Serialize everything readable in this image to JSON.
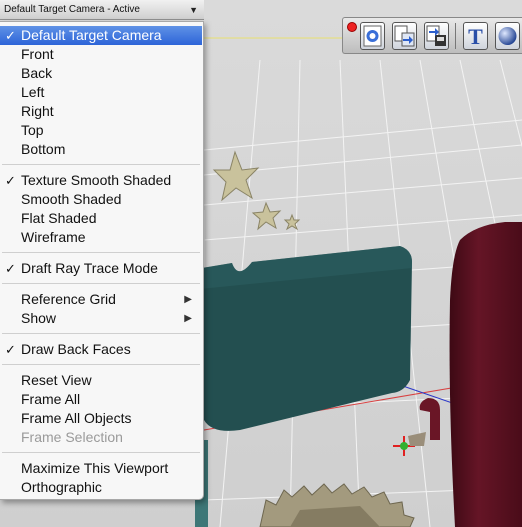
{
  "camera_bar": {
    "label": "Default Target Camera - Active",
    "arrow": "▼"
  },
  "toolbar": {
    "buttons": [
      {
        "icon": "refresh-render-icon"
      },
      {
        "icon": "import-icon"
      },
      {
        "icon": "export-icon"
      },
      {
        "icon": "text-tool-icon",
        "glyph": "T"
      },
      {
        "icon": "sphere-primitive-icon"
      }
    ]
  },
  "menu": {
    "check_glyph": "✓",
    "submenu_glyph": "▶",
    "items": {
      "default_target_camera": "Default Target Camera",
      "front": "Front",
      "back": "Back",
      "left": "Left",
      "right": "Right",
      "top": "Top",
      "bottom": "Bottom",
      "texture_smooth_shaded": "Texture Smooth Shaded",
      "smooth_shaded": "Smooth Shaded",
      "flat_shaded": "Flat Shaded",
      "wireframe": "Wireframe",
      "draft_ray_trace_mode": "Draft Ray Trace Mode",
      "reference_grid": "Reference Grid",
      "show": "Show",
      "draw_back_faces": "Draw Back Faces",
      "reset_view": "Reset View",
      "frame_all": "Frame All",
      "frame_all_objects": "Frame All Objects",
      "frame_selection": "Frame Selection",
      "maximize_this_viewport": "Maximize This Viewport",
      "orthographic": "Orthographic"
    }
  },
  "colors": {
    "selection": "#3b73dc",
    "teal_object": "#1f4a4a",
    "maroon_object": "#5a1020",
    "star": "#c8c09a"
  }
}
